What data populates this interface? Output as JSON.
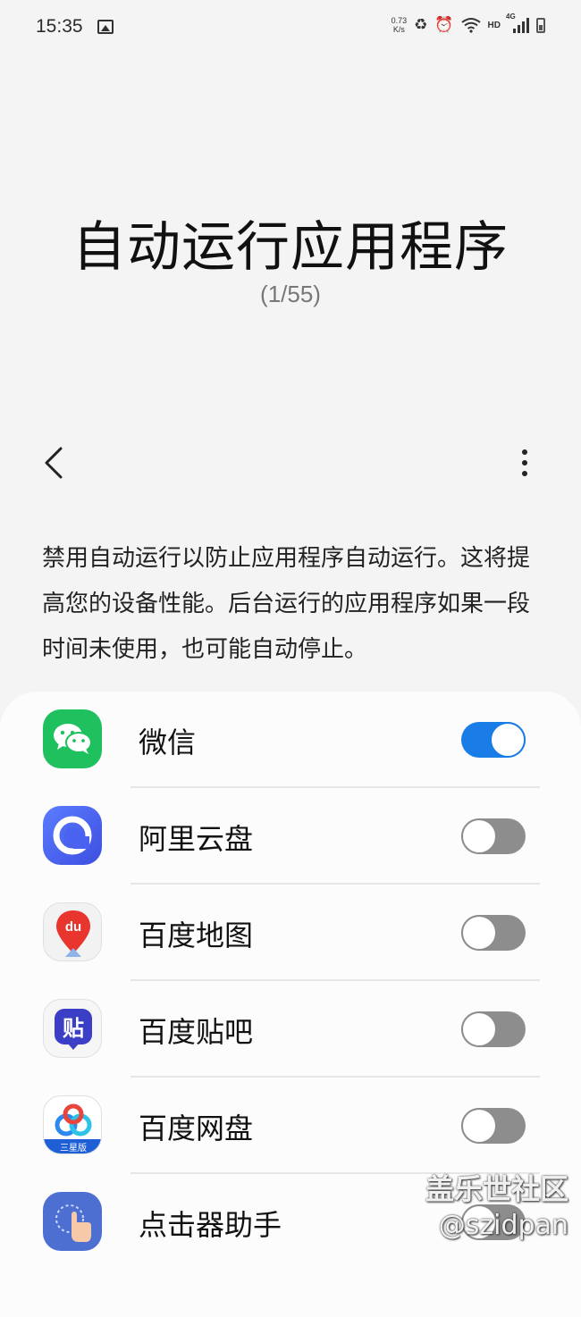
{
  "status_bar": {
    "time": "15:35",
    "net_speed_value": "0.73",
    "net_speed_unit": "K/s",
    "hd": "HD",
    "network": "4G",
    "icons": [
      "gallery-icon",
      "recycle-icon",
      "alarm-icon",
      "wifi-icon",
      "signal-icon",
      "battery-icon"
    ]
  },
  "header": {
    "title": "自动运行应用程序",
    "counter": "(1/55)"
  },
  "toolbar": {
    "back_icon": "chevron-left-icon",
    "more_icon": "more-vertical-icon"
  },
  "description": "禁用自动运行以防止应用程序自动运行。这将提高您的设备性能。后台运行的应用程序如果一段时间未使用，也可能自动停止。",
  "apps": [
    {
      "name": "微信",
      "icon": "wechat-icon",
      "enabled": true
    },
    {
      "name": "阿里云盘",
      "icon": "aliyun-drive-icon",
      "enabled": false
    },
    {
      "name": "百度地图",
      "icon": "baidu-map-icon",
      "icon_text": "du",
      "enabled": false
    },
    {
      "name": "百度贴吧",
      "icon": "baidu-tieba-icon",
      "icon_text": "贴",
      "enabled": false
    },
    {
      "name": "百度网盘",
      "icon": "baidu-netdisk-icon",
      "icon_text": "三星版",
      "enabled": false
    },
    {
      "name": "点击器助手",
      "icon": "clicker-assistant-icon",
      "enabled": false
    }
  ],
  "watermark": {
    "line1": "盖乐世社区",
    "line2": "@szidpan"
  },
  "colors": {
    "accent": "#1a7ce6",
    "toggle_off": "#8d8d8d",
    "background": "#f4f4f4",
    "card": "#fcfcfc"
  }
}
